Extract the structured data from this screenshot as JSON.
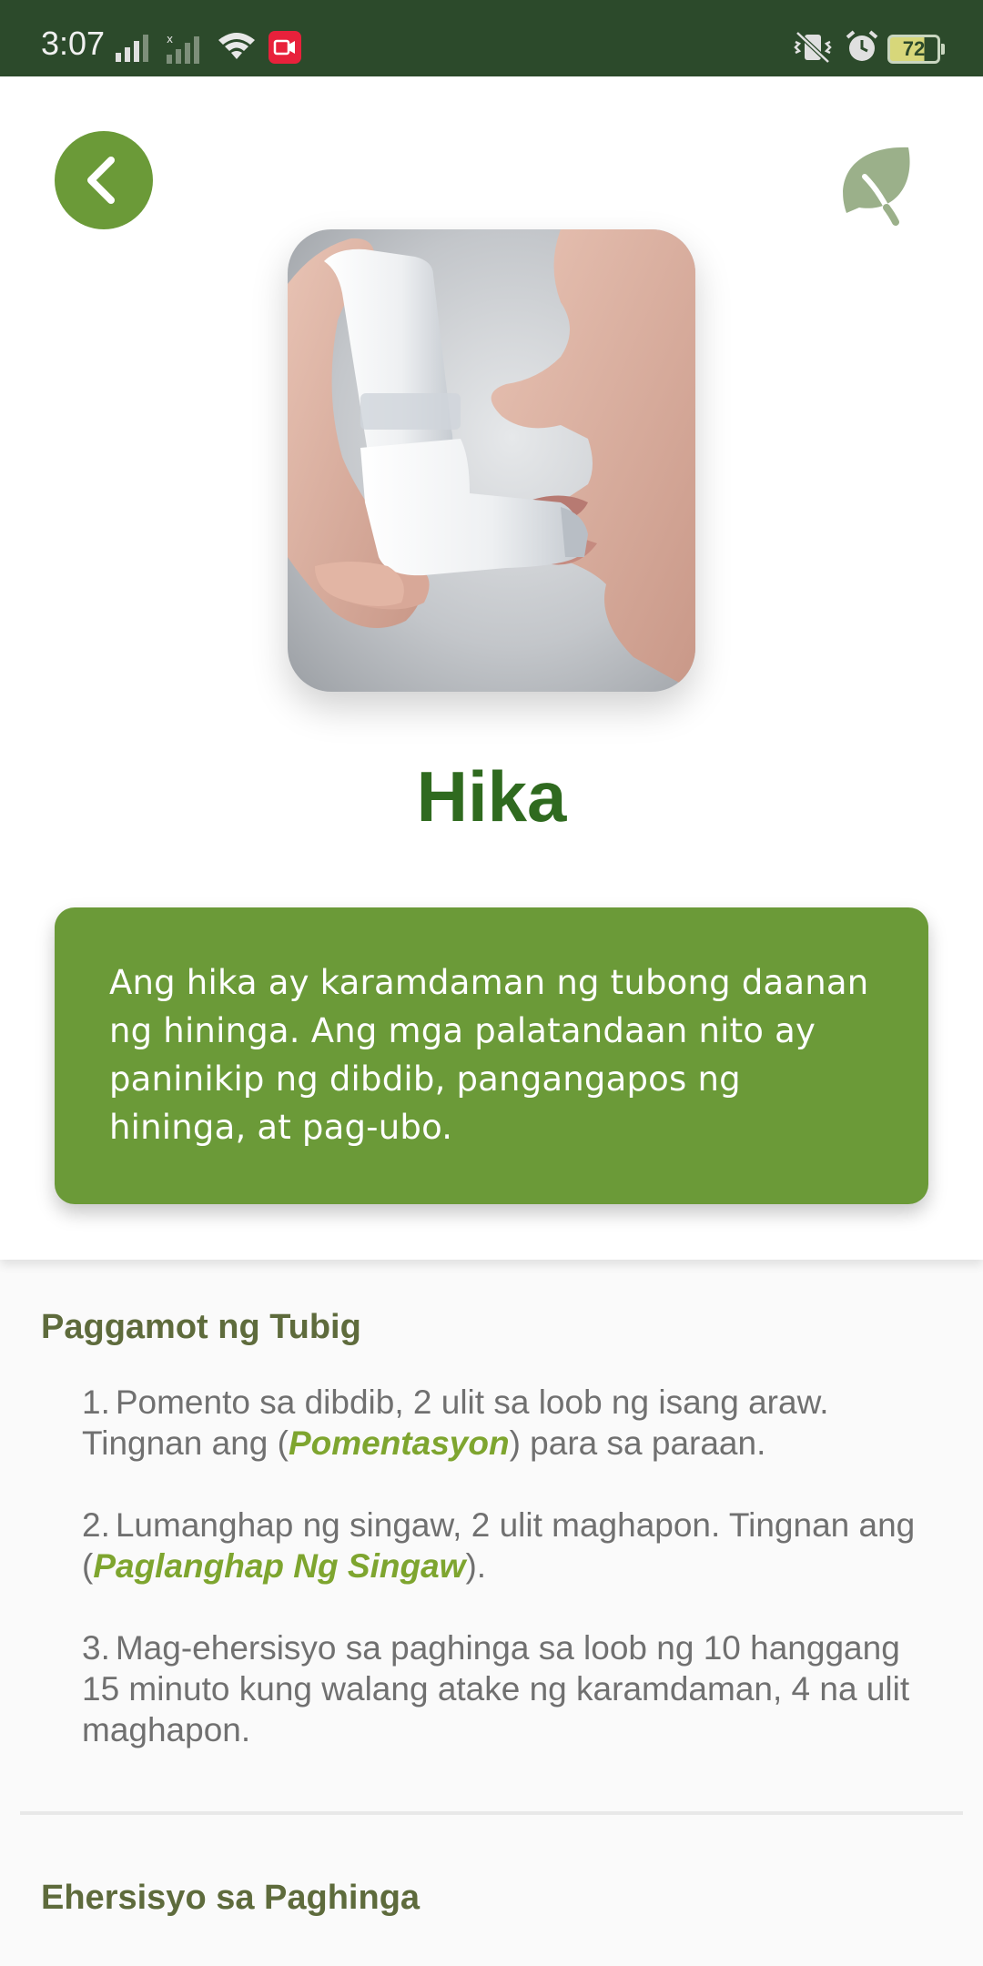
{
  "status_bar": {
    "time": "3:07",
    "battery": "72"
  },
  "header": {
    "title": "Hika",
    "description": "Ang hika ay karamdaman ng tubong daanan ng hininga. Ang mga palatandaan nito ay paninikip ng dibdib, pangangapos ng hininga, at pag-ubo.",
    "accent_color": "#6b9a38",
    "title_color": "#2f6a1f"
  },
  "icons": {
    "back": "chevron-left-icon",
    "leaf": "leaf-icon"
  },
  "section1": {
    "heading": "Paggamot ng Tubig",
    "steps": [
      {
        "num": "1.",
        "text_before": "Pomento sa dibdib, 2 ulit sa loob ng isang araw. Tingnan ang (",
        "link": "Pomentasyon",
        "text_after": ") para sa paraan."
      },
      {
        "num": "2.",
        "text_before": "Lumanghap ng singaw, 2 ulit maghapon. Tingnan ang (",
        "link": "Paglanghap Ng Singaw",
        "text_after": ")."
      },
      {
        "num": "3.",
        "text_before": "Mag-ehersisyo sa paghinga sa loob ng 10 hanggang 15 minuto kung walang atake ng karamdaman, 4 na ulit maghapon.",
        "link": "",
        "text_after": ""
      }
    ]
  },
  "section2": {
    "heading": "Ehersisyo sa Paghinga"
  }
}
